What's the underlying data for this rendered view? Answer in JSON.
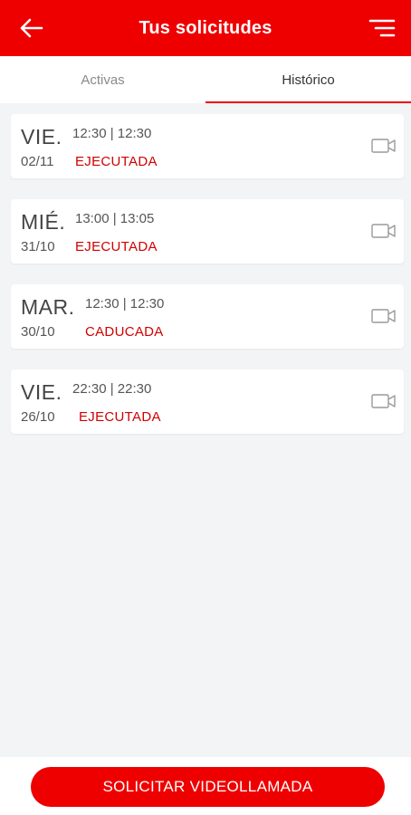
{
  "header": {
    "title": "Tus solicitudes",
    "back_icon": "arrow-left-icon",
    "menu_icon": "filter-menu-icon"
  },
  "tabs": [
    {
      "label": "Activas",
      "active": false
    },
    {
      "label": "Histórico",
      "active": true
    }
  ],
  "requests": [
    {
      "day": "VIE.",
      "date": "02/11",
      "time": "12:30 | 12:30",
      "status": "EJECUTADA",
      "icon": "video-camera-icon"
    },
    {
      "day": "MIÉ.",
      "date": "31/10",
      "time": "13:00 | 13:05",
      "status": "EJECUTADA",
      "icon": "video-camera-icon"
    },
    {
      "day": "MAR.",
      "date": "30/10",
      "time": "12:30 | 12:30",
      "status": "CADUCADA",
      "icon": "video-camera-icon"
    },
    {
      "day": "VIE.",
      "date": "26/10",
      "time": "22:30 | 22:30",
      "status": "EJECUTADA",
      "icon": "video-camera-icon"
    }
  ],
  "footer": {
    "cta_label": "SOLICITAR VIDEOLLAMADA"
  },
  "colors": {
    "brand": "#ee0000",
    "status": "#d10000",
    "background": "#f3f4f6"
  }
}
